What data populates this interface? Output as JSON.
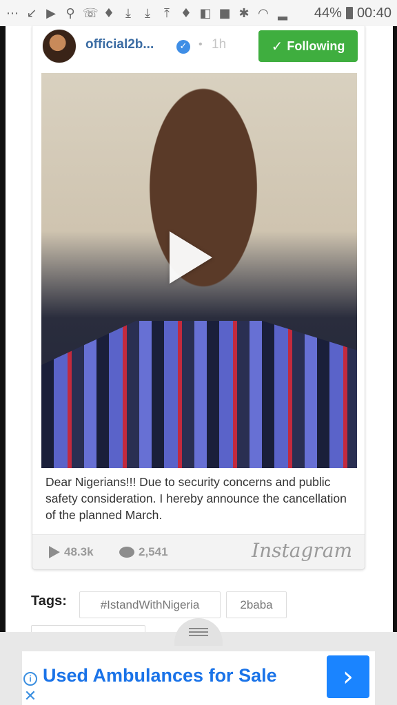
{
  "status_bar": {
    "icons": [
      "more-icon",
      "missed-call-icon",
      "youtube-icon",
      "maps-icon",
      "whatsapp-icon",
      "twitter-icon",
      "download-icon",
      "download-icon",
      "upload-icon",
      "twitter-icon",
      "flipboard-icon",
      "facebook-icon",
      "bluetooth-icon",
      "wifi-icon",
      "signal-icon"
    ],
    "battery_percent": "44%",
    "time": "00:40"
  },
  "post": {
    "username": "official2b...",
    "time_ago": "1h",
    "follow_label": "Following",
    "caption": "Dear Nigerians!!! Due to security concerns and public safety consideration. I hereby announce the cancellation of the planned March.",
    "plays": "48.3k",
    "comments": "2,541",
    "source_logo": "Instagram",
    "follow_color": "#3fae3f"
  },
  "tags": {
    "label": "Tags:",
    "items": [
      "#IstandWithNigeria",
      "2baba"
    ]
  },
  "ad": {
    "title": "Used Ambulances for Sale",
    "info_symbol": "i",
    "close_symbol": "✕",
    "arrow_symbol": "›",
    "accent": "#1a84ff"
  }
}
